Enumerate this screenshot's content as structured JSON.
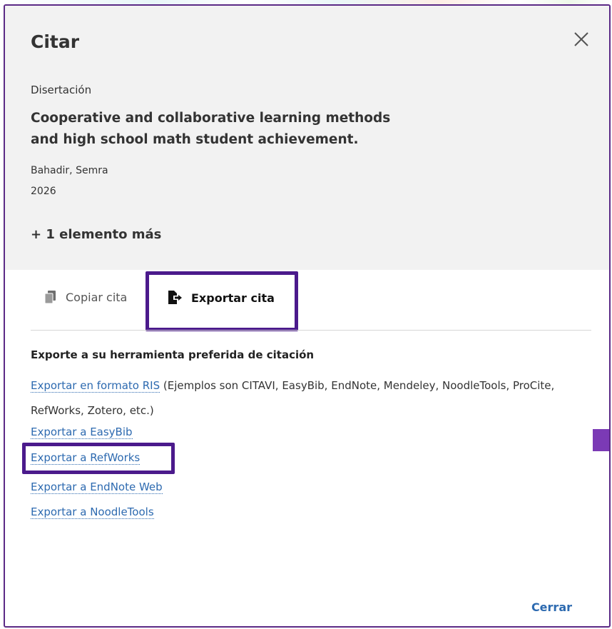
{
  "dialog": {
    "title": "Citar",
    "close_icon": "close-icon"
  },
  "record": {
    "type": "Disertación",
    "title_line1": "Cooperative and collaborative learning methods",
    "title_line2": "and high school math student achievement.",
    "author": "Bahadir, Semra",
    "year": "2026",
    "more_items": "+ 1 elemento más"
  },
  "tabs": [
    {
      "label": "Copiar cita",
      "icon": "copy-icon",
      "selected": false
    },
    {
      "label": "Exportar cita",
      "icon": "export-file-icon",
      "selected": true
    }
  ],
  "export": {
    "heading": "Exporte a su herramienta preferida de citación",
    "ris_link": "Exportar en formato RIS",
    "ris_description": " (Ejemplos son CITAVI, EasyBib, EndNote, Mendeley, NoodleTools, ProCite, RefWorks, Zotero, etc.)",
    "links": [
      "Exportar a EasyBib",
      "Exportar a RefWorks",
      "Exportar a EndNote Web",
      "Exportar a NoodleTools"
    ]
  },
  "footer": {
    "close_label": "Cerrar"
  },
  "colors": {
    "accent_highlight": "#4b1a8c",
    "link": "#2d6ab0",
    "header_bg": "#f2f2f2",
    "dialog_border": "#5b2a86"
  }
}
